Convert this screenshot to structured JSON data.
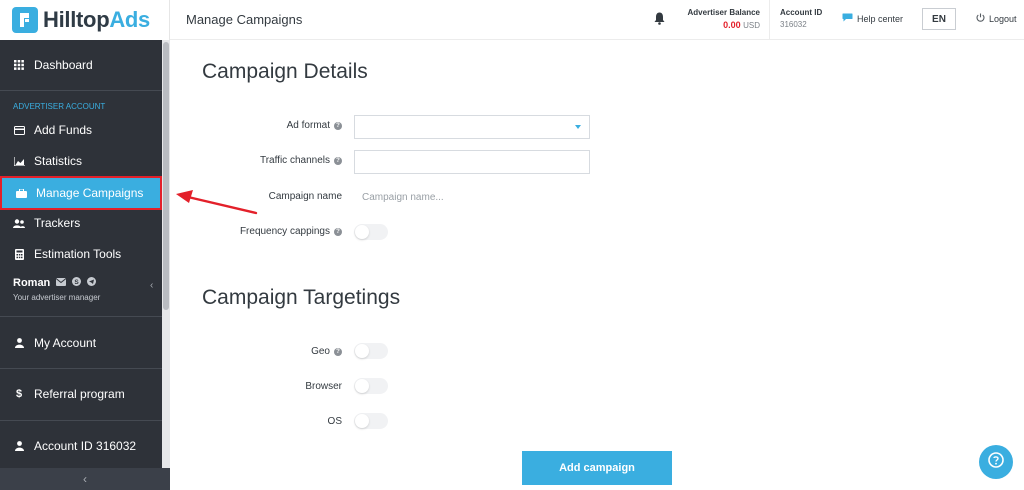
{
  "brand": {
    "name_part1": "Hilltop",
    "name_part2": "Ads"
  },
  "header": {
    "page_title": "Manage Campaigns",
    "balance_label": "Advertiser Balance",
    "balance_amount": "0.00",
    "balance_currency": "USD",
    "account_label": "Account ID",
    "account_value": "316032",
    "help_label": "Help center",
    "lang": "EN",
    "logout_label": "Logout"
  },
  "sidebar": {
    "section_label": "ADVERTISER ACCOUNT",
    "items": [
      {
        "label": "Dashboard",
        "icon": "grid-icon"
      },
      {
        "label": "Add Funds",
        "icon": "card-icon"
      },
      {
        "label": "Statistics",
        "icon": "chart-icon"
      },
      {
        "label": "Manage Campaigns",
        "icon": "briefcase-icon",
        "active": true
      },
      {
        "label": "Trackers",
        "icon": "users-icon"
      },
      {
        "label": "Estimation Tools",
        "icon": "calculator-icon"
      },
      {
        "label": "My Account",
        "icon": "user-icon"
      },
      {
        "label": "Referral program",
        "icon": "dollar-icon"
      },
      {
        "label": "Account ID 316032",
        "icon": "user-icon"
      }
    ],
    "manager": {
      "name": "Roman",
      "role": "Your advertiser manager"
    }
  },
  "main": {
    "details_title": "Campaign Details",
    "targeting_title": "Campaign Targetings",
    "fields": {
      "ad_format": "Ad format",
      "traffic_channels": "Traffic channels",
      "campaign_name": "Campaign name",
      "campaign_name_placeholder": "Campaign name...",
      "frequency_cappings": "Frequency cappings",
      "geo": "Geo",
      "browser": "Browser",
      "os": "OS"
    },
    "add_button": "Add campaign"
  },
  "colors": {
    "accent": "#3aaee0",
    "sidebar_bg": "#2e3239",
    "highlight": "#e3202a"
  }
}
